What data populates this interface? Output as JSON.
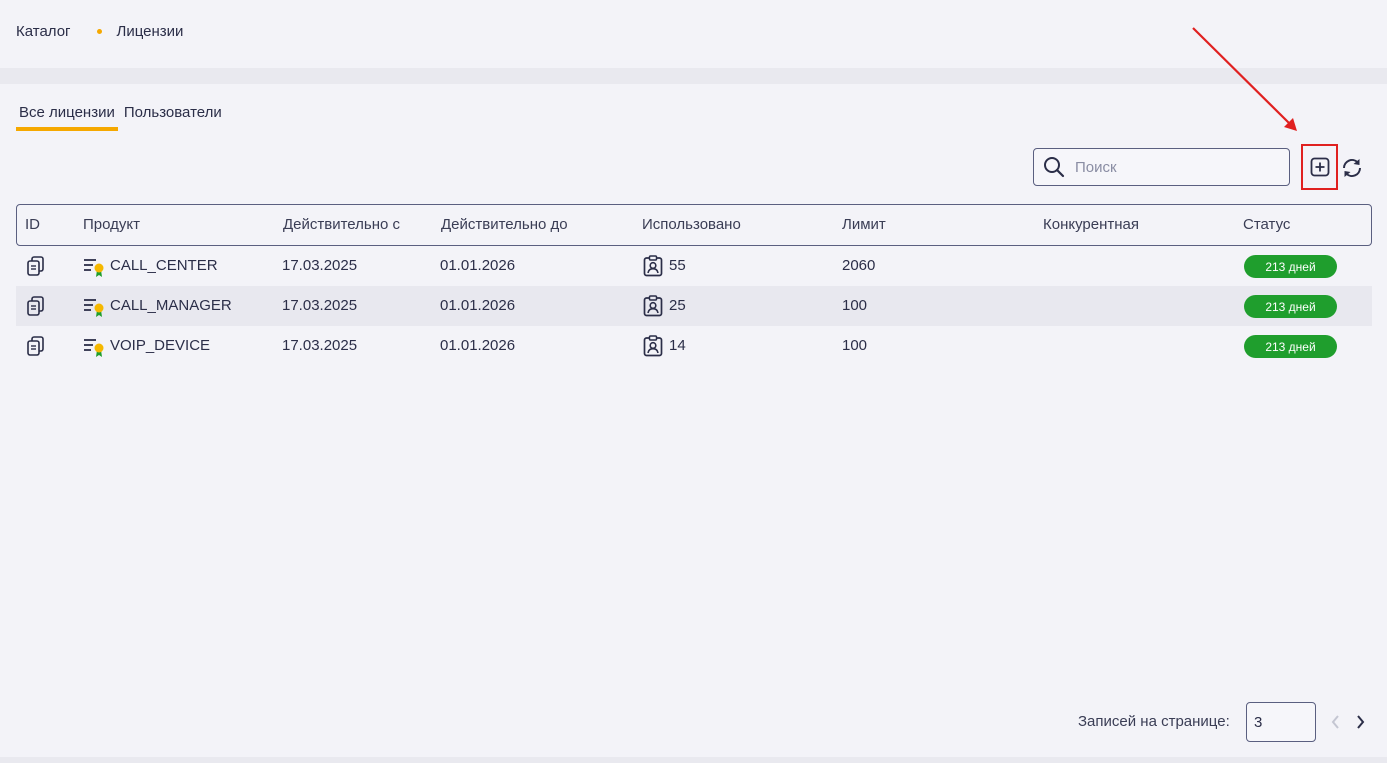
{
  "breadcrumb": {
    "root": "Каталог",
    "current": "Лицензии"
  },
  "tabs": [
    {
      "label": "Все лицензии",
      "active": true
    },
    {
      "label": "Пользователи",
      "active": false
    }
  ],
  "search": {
    "placeholder": "Поиск",
    "value": ""
  },
  "table": {
    "headers": [
      "ID",
      "Продукт",
      "Действительно с",
      "Действительно до",
      "Использовано",
      "Лимит",
      "Конкурентная",
      "Статус"
    ],
    "rows": [
      {
        "product": "CALL_CENTER",
        "valid_from": "17.03.2025",
        "valid_to": "01.01.2026",
        "used": "55",
        "limit": "2060",
        "concurrent": "",
        "status": "213 дней"
      },
      {
        "product": "CALL_MANAGER",
        "valid_from": "17.03.2025",
        "valid_to": "01.01.2026",
        "used": "25",
        "limit": "100",
        "concurrent": "",
        "status": "213 дней"
      },
      {
        "product": "VOIP_DEVICE",
        "valid_from": "17.03.2025",
        "valid_to": "01.01.2026",
        "used": "14",
        "limit": "100",
        "concurrent": "",
        "status": "213 дней"
      }
    ]
  },
  "pagination": {
    "label": "Записей на странице:",
    "per_page": "3"
  },
  "colors": {
    "accent": "#f5a800",
    "status_ok": "#1f9e2d",
    "highlight": "#e02020"
  }
}
